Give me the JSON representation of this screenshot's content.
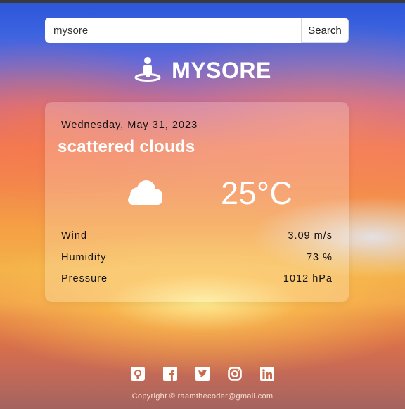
{
  "search": {
    "value": "mysore",
    "button_label": "Search"
  },
  "city": {
    "name": "MYSORE",
    "icon": "person-pin-icon"
  },
  "weather": {
    "date": "Wednesday, May 31, 2023",
    "description": "scattered clouds",
    "icon": "cloud-icon",
    "temperature": "25°C",
    "stats": [
      {
        "label": "Wind",
        "value": "3.09 m/s"
      },
      {
        "label": "Humidity",
        "value": "73 %"
      },
      {
        "label": "Pressure",
        "value": "1012 hPa"
      }
    ]
  },
  "footer": {
    "social_icons": [
      "github-icon",
      "facebook-icon",
      "twitter-icon",
      "instagram-icon",
      "linkedin-icon"
    ],
    "copyright": "Copyright © raamthecoder@gmail.com"
  },
  "colors": {
    "card_bg": "rgba(255,255,255,0.22)",
    "text_light": "#ffffff",
    "text_dark": "#111111"
  }
}
